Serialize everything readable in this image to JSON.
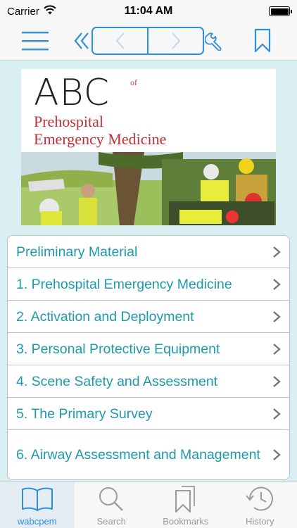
{
  "status_bar": {
    "carrier": "Carrier",
    "time": "11:04 AM",
    "wifi_icon": "wifi-icon",
    "battery_icon": "battery-icon",
    "battery_level": 1.0
  },
  "toolbar": {
    "menu_icon": "hamburger-menu-icon",
    "rewind_icon": "double-chevron-left-icon",
    "back_icon": "chevron-left-icon",
    "forward_icon": "chevron-right-icon",
    "tools_icon": "wrench-icon",
    "bookmark_icon": "bookmark-icon",
    "accent_color": "#2f8fdc"
  },
  "cover": {
    "title_main": "ABC",
    "title_of": "of",
    "subtitle_line1": "Prehospital",
    "subtitle_line2": "Emergency Medicine"
  },
  "toc": {
    "items": [
      {
        "label": "Preliminary Material"
      },
      {
        "label": "1. Prehospital Emergency Medicine"
      },
      {
        "label": "2. Activation and Deployment"
      },
      {
        "label": "3. Personal Protective Equipment"
      },
      {
        "label": "4. Scene Safety and Assessment"
      },
      {
        "label": "5. The Primary Survey"
      },
      {
        "label": "6. Airway Assessment and Management"
      }
    ],
    "text_color": "#1e9aad",
    "chevron_icon": "chevron-right-icon"
  },
  "tabbar": {
    "tabs": [
      {
        "label": "wabcpem",
        "icon": "book-icon",
        "active": true
      },
      {
        "label": "Search",
        "icon": "magnifier-icon",
        "active": false
      },
      {
        "label": "Bookmarks",
        "icon": "bookmarks-icon",
        "active": false
      },
      {
        "label": "History",
        "icon": "history-clock-icon",
        "active": false
      }
    ]
  }
}
